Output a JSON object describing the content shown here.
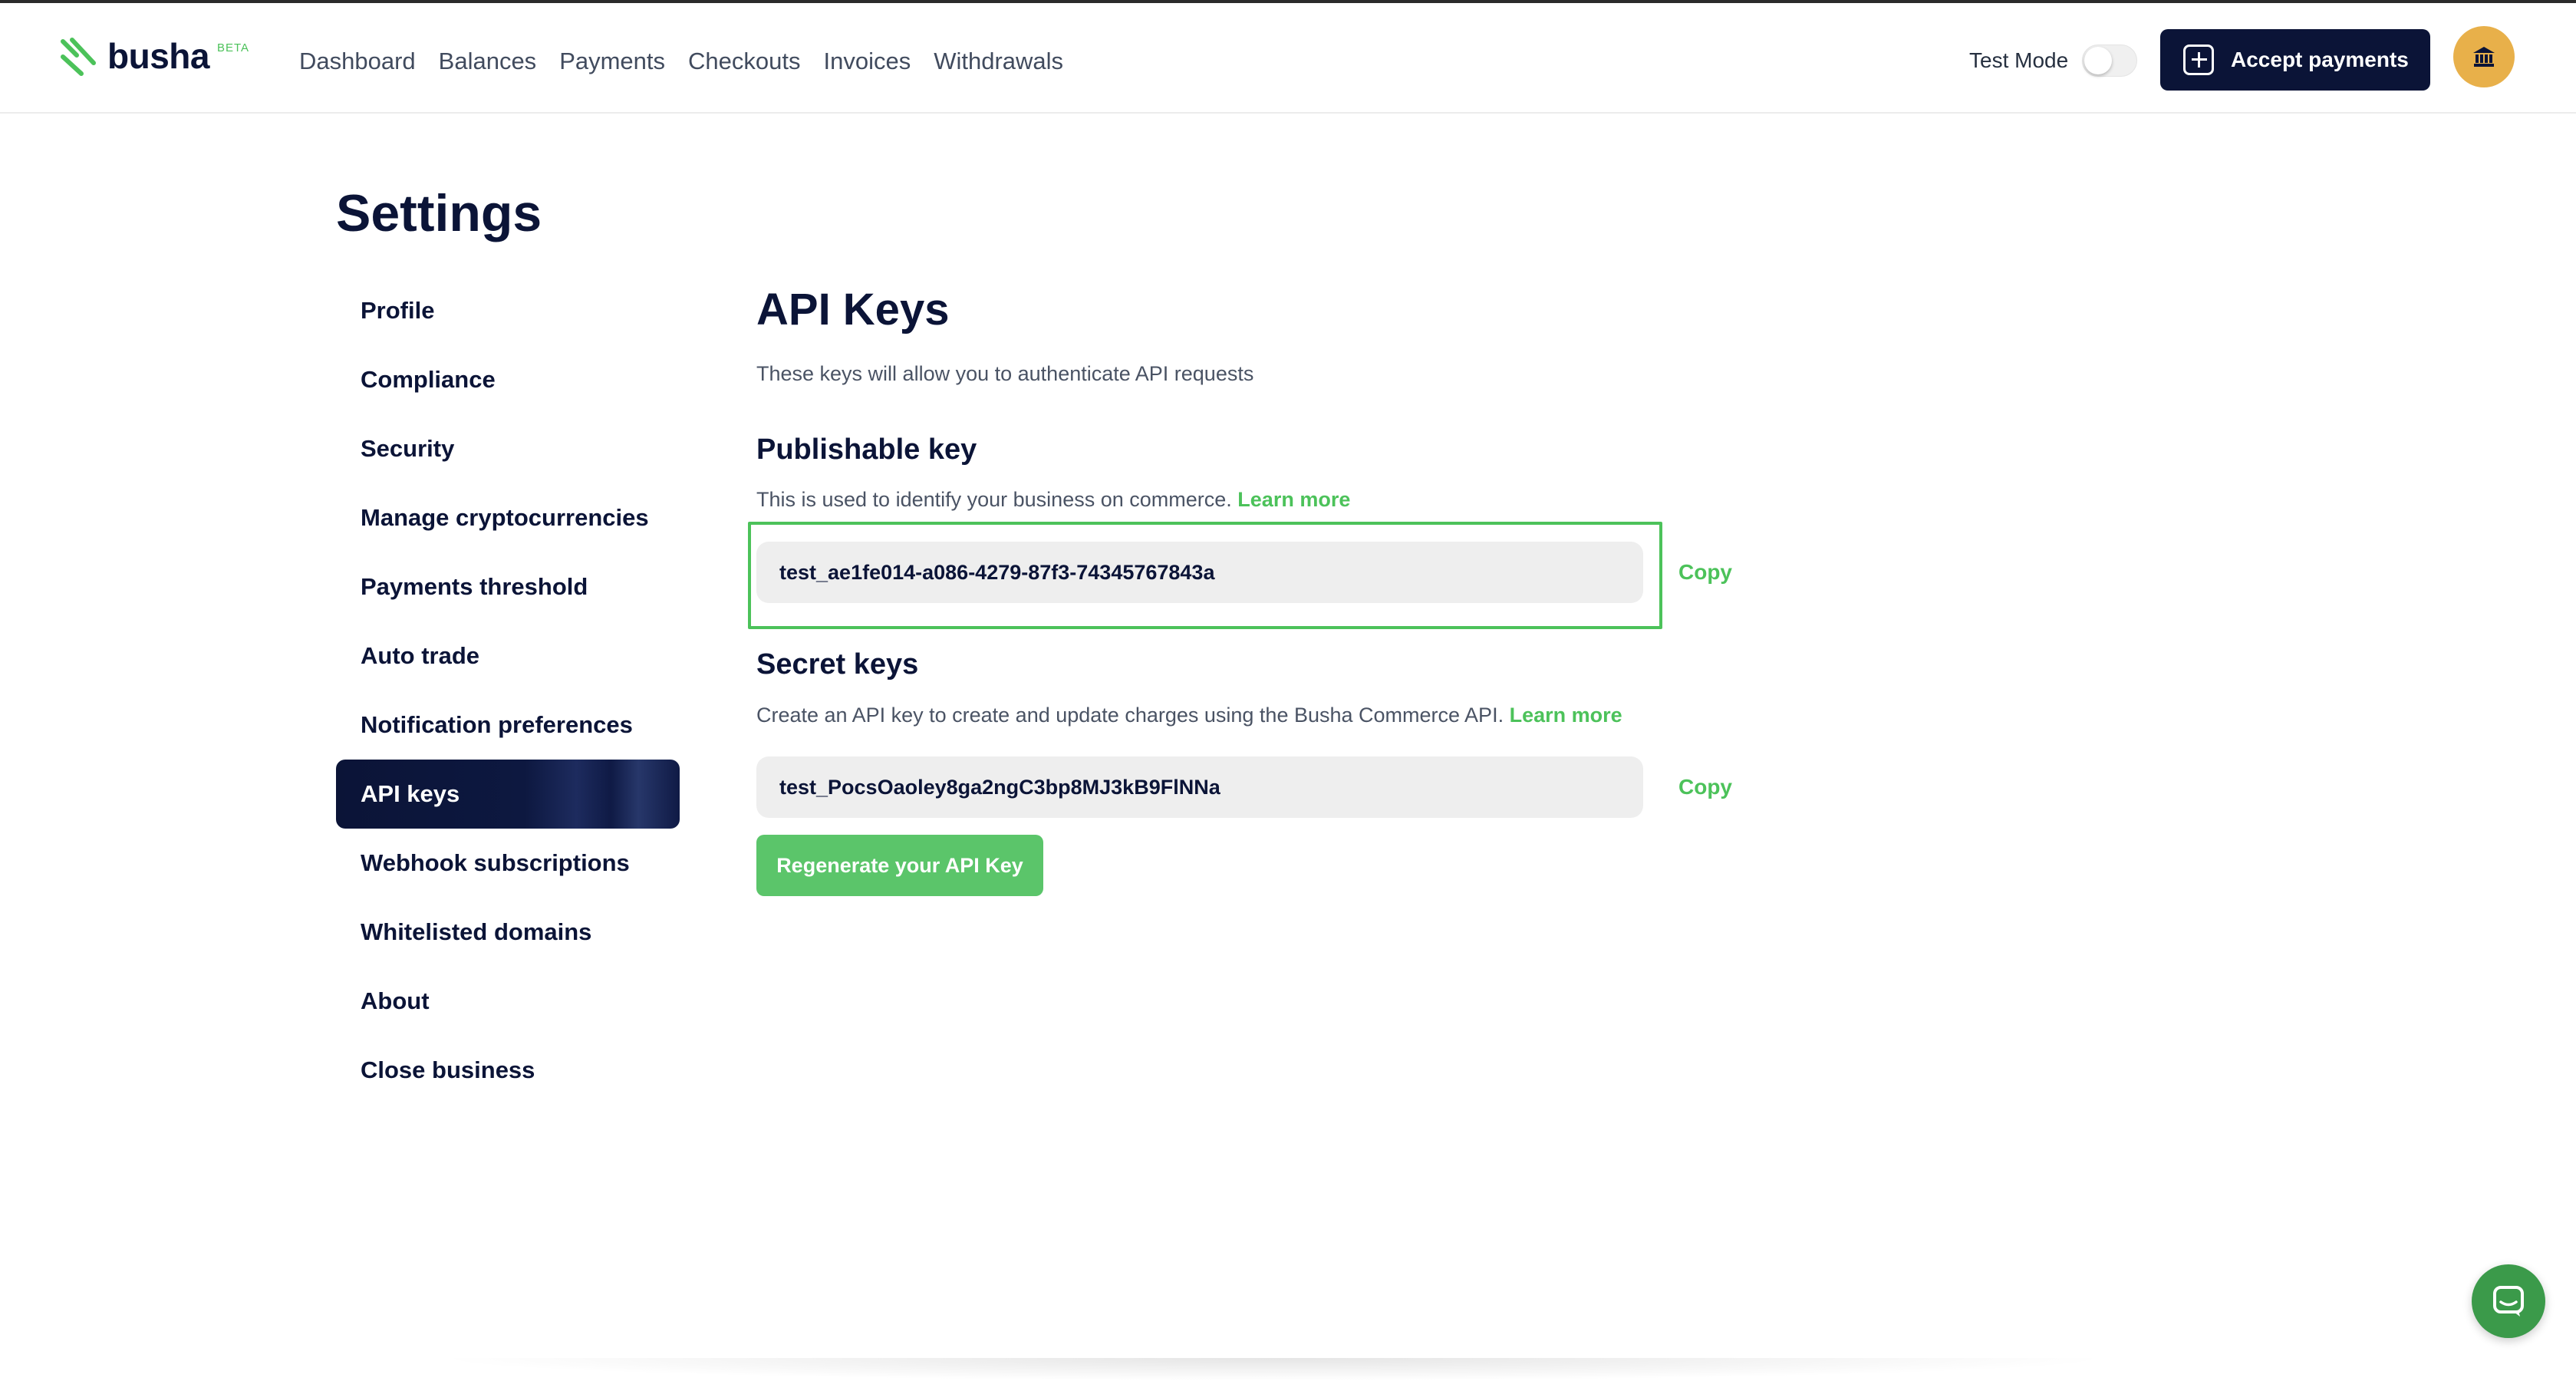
{
  "brand": {
    "name": "busha",
    "badge": "BETA",
    "accent_color": "#4cc25a",
    "navy_color": "#0b1437"
  },
  "nav": {
    "items": [
      "Dashboard",
      "Balances",
      "Payments",
      "Checkouts",
      "Invoices",
      "Withdrawals"
    ]
  },
  "header": {
    "test_mode_label": "Test Mode",
    "test_mode_on": false,
    "accept_payments_label": "Accept payments",
    "avatar_icon": "bank-icon"
  },
  "page": {
    "title": "Settings"
  },
  "sidebar": {
    "items": [
      "Profile",
      "Compliance",
      "Security",
      "Manage cryptocurrencies",
      "Payments threshold",
      "Auto trade",
      "Notification preferences",
      "API keys",
      "Webhook subscriptions",
      "Whitelisted domains",
      "About",
      "Close business"
    ],
    "active": "API keys"
  },
  "api": {
    "title": "API Keys",
    "description": "These keys will allow you to authenticate API requests",
    "publishable": {
      "title": "Publishable key",
      "description": "This is used to identify your business on commerce.",
      "learn_more": "Learn more",
      "value": "test_ae1fe014-a086-4279-87f3-74345767843a",
      "copy_label": "Copy"
    },
    "secret": {
      "title": "Secret keys",
      "description": "Create an API key to create and update charges using the Busha Commerce API.",
      "learn_more": "Learn more",
      "value": "test_PocsOaoley8ga2ngC3bp8MJ3kB9FlNNa",
      "copy_label": "Copy"
    },
    "regenerate_label": "Regenerate your API Key"
  },
  "chat": {
    "icon": "chat-icon"
  }
}
